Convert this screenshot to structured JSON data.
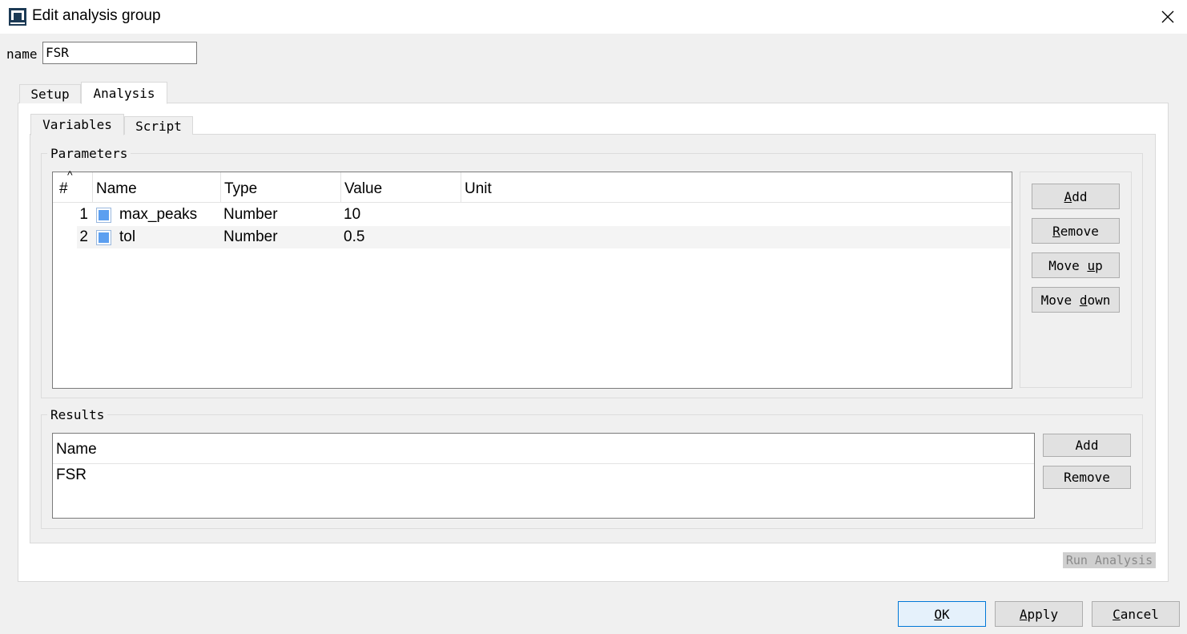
{
  "window": {
    "title": "Edit analysis group",
    "icon": "app-icon",
    "close_icon": "close-icon"
  },
  "name_field": {
    "label": "name",
    "value": "FSR"
  },
  "outer_tabs": [
    {
      "label": "Setup",
      "active": false
    },
    {
      "label": "Analysis",
      "active": true
    }
  ],
  "inner_tabs": [
    {
      "label": "Variables",
      "active": true
    },
    {
      "label": "Script",
      "active": false
    }
  ],
  "parameters": {
    "legend": "Parameters",
    "sort_indicator": "^",
    "columns": [
      "#",
      "Name",
      "Type",
      "Value",
      "Unit"
    ],
    "rows": [
      {
        "num": "1",
        "name": "max_peaks",
        "type": "Number",
        "value": "10",
        "unit": ""
      },
      {
        "num": "2",
        "name": "tol",
        "type": "Number",
        "value": "0.5",
        "unit": ""
      }
    ],
    "buttons": {
      "add": {
        "pre": "",
        "u": "A",
        "post": "dd"
      },
      "remove": {
        "pre": "",
        "u": "R",
        "post": "emove"
      },
      "move_up": {
        "pre": "Move ",
        "u": "u",
        "post": "p"
      },
      "move_down": {
        "pre": "Move ",
        "u": "d",
        "post": "own"
      }
    }
  },
  "results": {
    "legend": "Results",
    "column": "Name",
    "rows": [
      "FSR"
    ],
    "buttons": {
      "add": "Add",
      "remove": "Remove"
    }
  },
  "run_analysis": "Run Analysis",
  "footer": {
    "ok": {
      "u": "O",
      "post": "K"
    },
    "apply": {
      "u": "A",
      "post": "pply"
    },
    "cancel": {
      "u": "C",
      "post": "ancel"
    }
  },
  "colors": {
    "param_icon": "#5c9ff0",
    "ok_border": "#0078d7",
    "background": "#f0f0f0"
  }
}
